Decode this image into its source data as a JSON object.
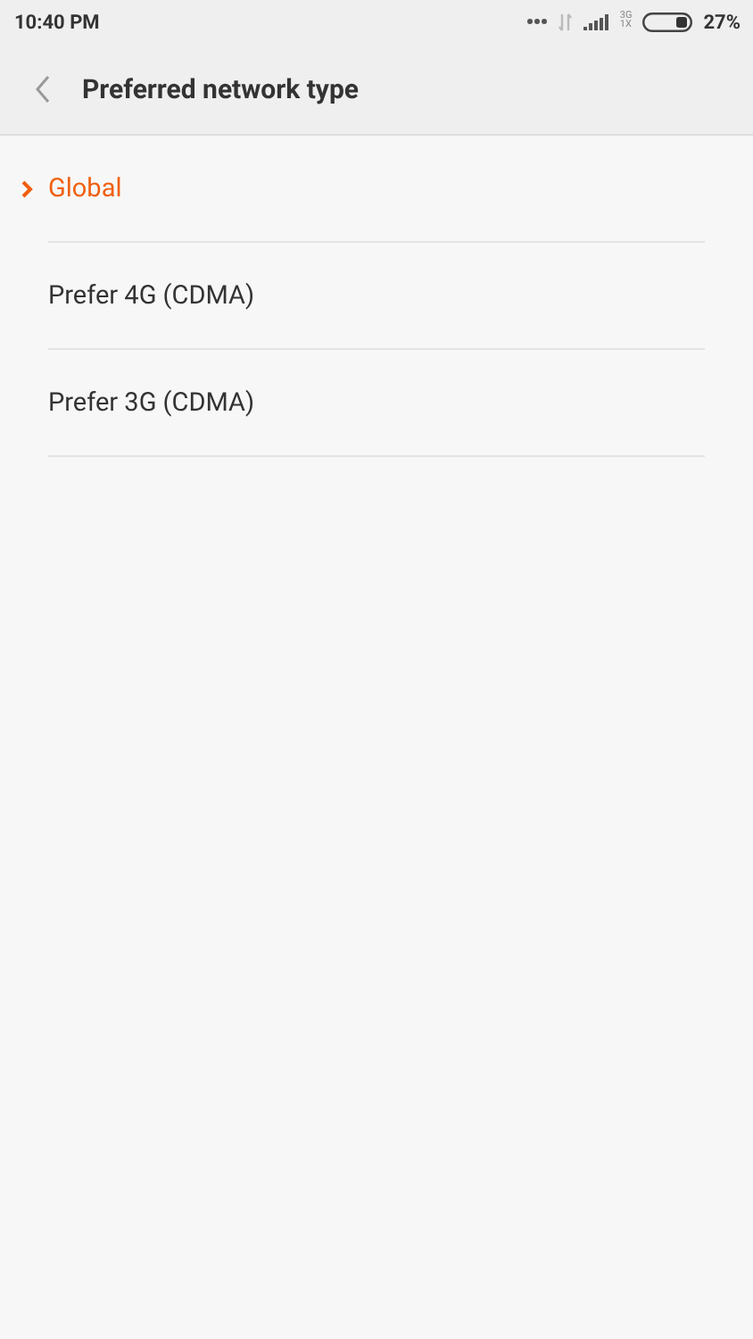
{
  "status_bar": {
    "time": "10:40 PM",
    "network_top": "3G",
    "network_bottom": "1X",
    "battery": "27%"
  },
  "header": {
    "title": "Preferred network type"
  },
  "options": [
    {
      "label": "Global",
      "selected": true
    },
    {
      "label": "Prefer 4G (CDMA)",
      "selected": false
    },
    {
      "label": "Prefer 3G (CDMA)",
      "selected": false
    }
  ]
}
